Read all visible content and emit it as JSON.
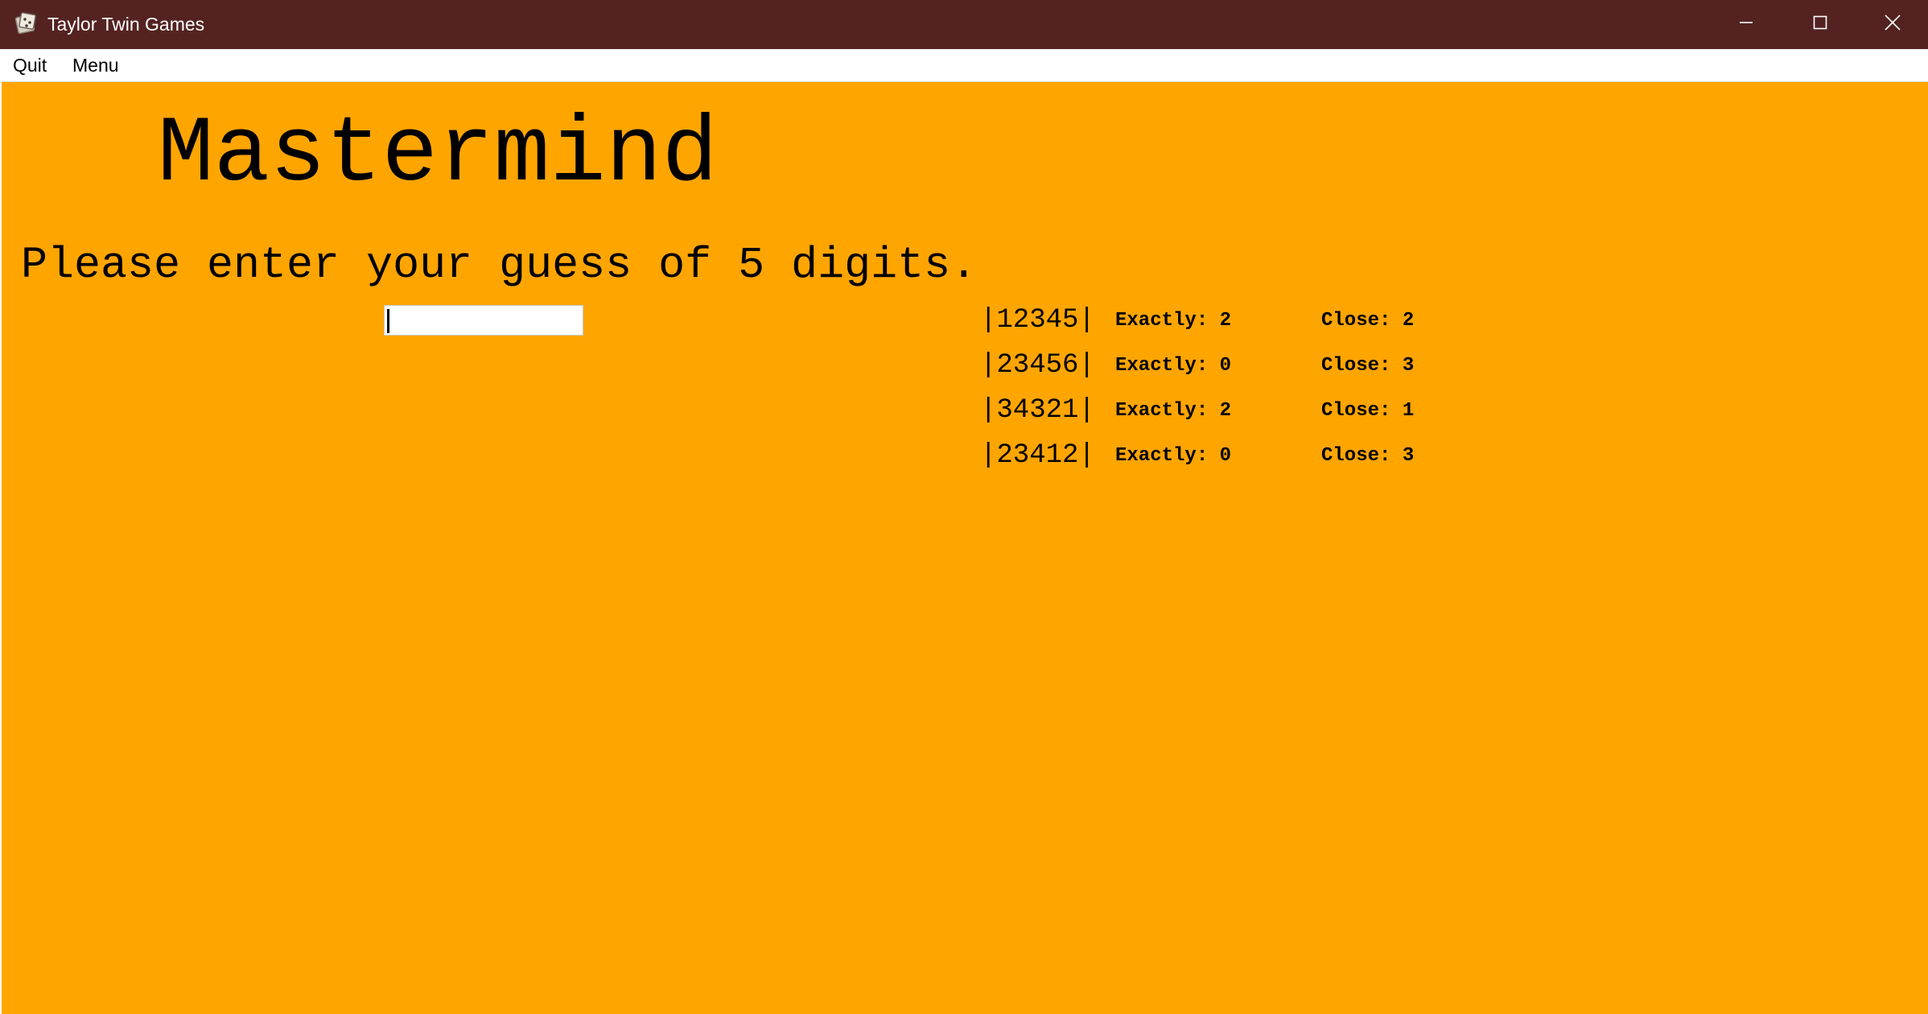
{
  "window": {
    "title": "Taylor Twin Games",
    "app_icon": "app-game-icon",
    "controls": [
      "minimize-icon",
      "maximize-icon",
      "close-icon"
    ],
    "colors": {
      "titlebar": "#542321",
      "background": "#ffa500",
      "menubar": "#ffffff"
    }
  },
  "menubar": {
    "quit_label": "Quit",
    "menu_label": "Menu"
  },
  "game": {
    "title": "Mastermind",
    "prompt": "Please enter your guess of 5 digits.",
    "input_value": ""
  },
  "history": [
    {
      "guess": "|12345|",
      "exactly": "Exactly: 2",
      "close": "Close: 2"
    },
    {
      "guess": "|23456|",
      "exactly": "Exactly: 0",
      "close": "Close: 3"
    },
    {
      "guess": "|34321|",
      "exactly": "Exactly: 2",
      "close": "Close: 1"
    },
    {
      "guess": "|23412|",
      "exactly": "Exactly: 0",
      "close": "Close: 3"
    }
  ]
}
